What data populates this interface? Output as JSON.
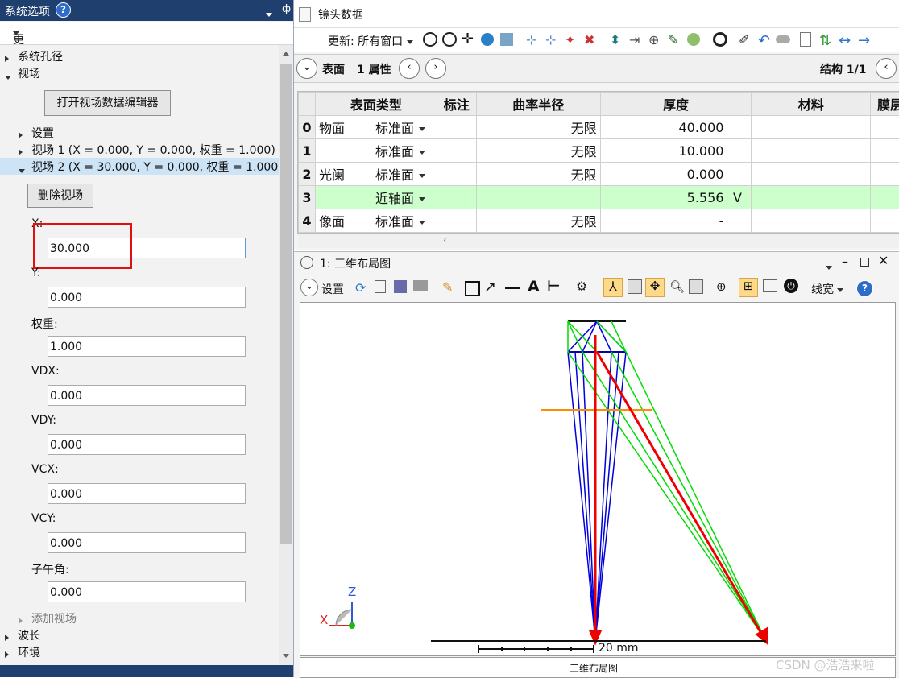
{
  "left_panel": {
    "title": "系统选项",
    "help": "?",
    "update_label": "更新: 所有窗口",
    "tree": {
      "aperture": "系统孔径",
      "fields": "视场",
      "open_editor_button": "打开视场数据编辑器",
      "settings": "设置",
      "field1": "视场 1 (X = 0.000, Y = 0.000, 权重 = 1.000)",
      "field2": "视场 2 (X = 30.000, Y = 0.000, 权重 = 1.000)",
      "delete_button": "删除视场",
      "add_field": "添加视场",
      "wavelength": "波长",
      "environment": "环境"
    },
    "form": {
      "x_label": "X:",
      "x_value": "30.000",
      "y_label": "Y:",
      "y_value": "0.000",
      "weight_label": "权重:",
      "weight_value": "1.000",
      "vdx_label": "VDX:",
      "vdx_value": "0.000",
      "vdy_label": "VDY:",
      "vdy_value": "0.000",
      "vcx_label": "VCX:",
      "vcx_value": "0.000",
      "vcy_label": "VCY:",
      "vcy_value": "0.000",
      "angle_label": "子午角:",
      "angle_value": "0.000"
    }
  },
  "lens_data": {
    "title": "镜头数据",
    "update_label": "更新: 所有窗口",
    "nav_surface": "表面",
    "nav_props": "1 属性",
    "config": "结构 1/1",
    "columns": [
      "",
      "表面类型",
      "标注",
      "曲率半径",
      "厚度",
      "材料",
      "膜层"
    ],
    "rows": [
      {
        "n": "0",
        "name": "物面",
        "type": "标准面",
        "radius": "无限",
        "thickness": "40.000",
        "flag": ""
      },
      {
        "n": "1",
        "name": "",
        "type": "标准面",
        "radius": "无限",
        "thickness": "10.000",
        "flag": ""
      },
      {
        "n": "2",
        "name": "光阑",
        "type": "标准面",
        "radius": "无限",
        "thickness": "0.000",
        "flag": ""
      },
      {
        "n": "3",
        "name": "",
        "type": "近轴面",
        "radius": "",
        "thickness": "5.556",
        "flag": "V"
      },
      {
        "n": "4",
        "name": "像面",
        "type": "标准面",
        "radius": "无限",
        "thickness": "-",
        "flag": ""
      }
    ],
    "highlight_row_color": "#ccffcc"
  },
  "layout": {
    "title": "1: 三维布局图",
    "settings_label": "设置",
    "line_width_label": "线宽",
    "scale_label": "20 mm",
    "footer": "三维布局图",
    "axis_z": "Z",
    "axis_x": "X",
    "colors": {
      "field1": "#0000dd",
      "field2": "#00dd00",
      "chief": "#ee0000",
      "stop": "#ff8c00"
    }
  },
  "watermark": "CSDN @浩浩来啦"
}
